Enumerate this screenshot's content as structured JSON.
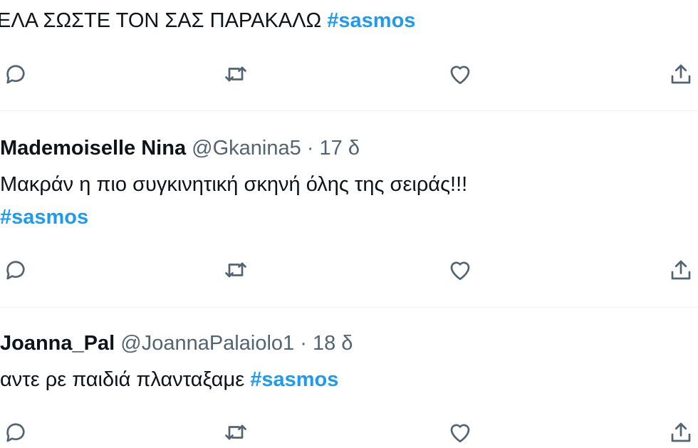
{
  "tweets": [
    {
      "text": "ΕΛΑ ΣΩΣΤΕ ΤΟΝ ΣΑΣ ΠΑΡΑΚΑΛΩ",
      "hashtag": "#sasmos"
    },
    {
      "author": "Mademoiselle Nina",
      "handle": "@Gkanina5",
      "separator": "·",
      "time": "17 δ",
      "text": "Μακράν η πιο συγκινητική σκηνή όλης της σειράς!!!",
      "hashtag": "#sasmos"
    },
    {
      "author": "Joanna_Pal",
      "handle": "@JoannaPalaiolo1",
      "separator": "·",
      "time": "18 δ",
      "text": "αντε ρε παιδιά πλανταξαμε",
      "hashtag": "#sasmos"
    }
  ],
  "icons": {
    "reply": "reply-icon",
    "retweet": "retweet-icon",
    "like": "like-icon",
    "share": "share-icon"
  },
  "colors": {
    "hashtag": "#1d9bf0",
    "text": "#0f1419",
    "muted": "#536471",
    "divider": "#eff3f4"
  }
}
